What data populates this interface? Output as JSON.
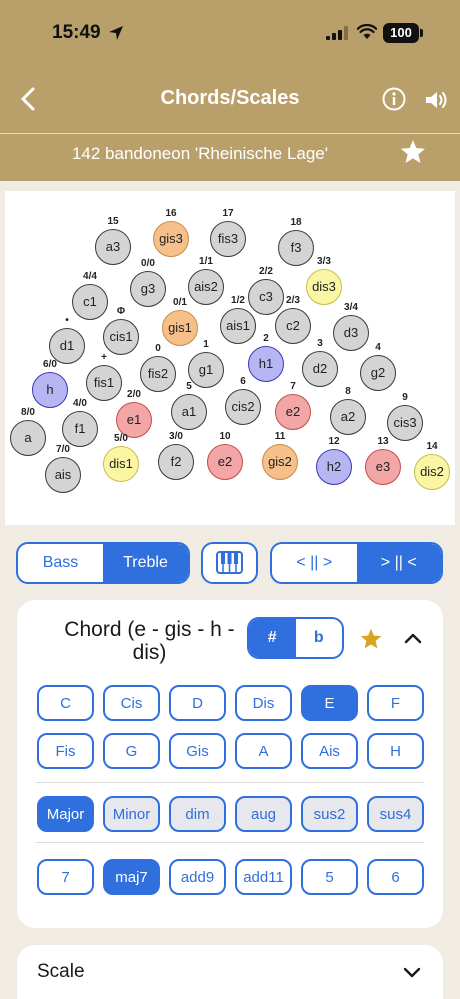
{
  "status": {
    "time": "15:49",
    "battery": "100"
  },
  "header": {
    "title": "Chords/Scales"
  },
  "instrument": {
    "name": "142 bandoneon 'Rheinische Lage'"
  },
  "colors": {
    "header_bg": "#b9a06a",
    "accent_blue": "#2f6fde",
    "page_bg": "#f1ece3",
    "key_default": "#d4d4d4",
    "key_orange": "#f6c08a",
    "key_yellow": "#fbf6a4",
    "key_blue": "#b8b6f2",
    "key_red": "#f2a6a6",
    "star_gold": "#d9a520"
  },
  "icons": [
    "location-arrow-icon",
    "signal-icon",
    "wifi-icon",
    "back-chevron-icon",
    "info-icon",
    "speaker-icon",
    "star-icon",
    "piano-icon",
    "chevron-up-icon",
    "chevron-down-icon"
  ],
  "keys": [
    {
      "label": "a3",
      "num": "15",
      "color": "default"
    },
    {
      "label": "gis3",
      "num": "16",
      "color": "orange"
    },
    {
      "label": "fis3",
      "num": "17",
      "color": "default"
    },
    {
      "label": "f3",
      "num": "18",
      "color": "default"
    },
    {
      "label": "c1",
      "num": "4/4",
      "color": "default"
    },
    {
      "label": "g3",
      "num": "0/0",
      "color": "default"
    },
    {
      "label": "ais2",
      "num": "1/1",
      "color": "default"
    },
    {
      "label": "c3",
      "num": "2/2",
      "color": "default"
    },
    {
      "label": "dis3",
      "num": "3/3",
      "color": "yellow"
    },
    {
      "label": "d1",
      "num": "•",
      "color": "default"
    },
    {
      "label": "cis1",
      "num": "Φ",
      "color": "default"
    },
    {
      "label": "gis1",
      "num": "0/1",
      "color": "orange"
    },
    {
      "label": "ais1",
      "num": "1/2",
      "color": "default"
    },
    {
      "label": "c2",
      "num": "2/3",
      "color": "default"
    },
    {
      "label": "d3",
      "num": "3/4",
      "color": "default"
    },
    {
      "label": "h",
      "num": "6/0",
      "color": "blue"
    },
    {
      "label": "fis1",
      "num": "+",
      "color": "default"
    },
    {
      "label": "fis2",
      "num": "0",
      "color": "default"
    },
    {
      "label": "g1",
      "num": "1",
      "color": "default"
    },
    {
      "label": "h1",
      "num": "2",
      "color": "blue"
    },
    {
      "label": "d2",
      "num": "3",
      "color": "default"
    },
    {
      "label": "g2",
      "num": "4",
      "color": "default"
    },
    {
      "label": "a",
      "num": "8/0",
      "color": "default"
    },
    {
      "label": "f1",
      "num": "4/0",
      "color": "default"
    },
    {
      "label": "e1",
      "num": "2/0",
      "color": "red"
    },
    {
      "label": "a1",
      "num": "5",
      "color": "default"
    },
    {
      "label": "cis2",
      "num": "6",
      "color": "default"
    },
    {
      "label": "e2",
      "num": "7",
      "color": "red"
    },
    {
      "label": "a2",
      "num": "8",
      "color": "default"
    },
    {
      "label": "cis3",
      "num": "9",
      "color": "default"
    },
    {
      "label": "ais",
      "num": "7/0",
      "color": "default"
    },
    {
      "label": "dis1",
      "num": "5/0",
      "color": "yellow"
    },
    {
      "label": "f2",
      "num": "3/0",
      "color": "default"
    },
    {
      "label": "e2",
      "num": "10",
      "color": "red"
    },
    {
      "label": "gis2",
      "num": "11",
      "color": "orange"
    },
    {
      "label": "h2",
      "num": "12",
      "color": "blue"
    },
    {
      "label": "e3",
      "num": "13",
      "color": "red"
    },
    {
      "label": "dis2",
      "num": "14",
      "color": "yellow"
    }
  ],
  "controls": {
    "bass": "Bass",
    "treble": "Treble",
    "selected_side": "Treble",
    "push": "< || >",
    "pull": "> || <",
    "selected_direction": "> || <"
  },
  "chord": {
    "title": "Chord (e - gis - h - dis)",
    "sharp": "#",
    "flat": "b",
    "selected_accidental": "#",
    "roots": [
      "C",
      "Cis",
      "D",
      "Dis",
      "E",
      "F",
      "Fis",
      "G",
      "Gis",
      "A",
      "Ais",
      "H"
    ],
    "selected_root": "E",
    "qualities": [
      "Major",
      "Minor",
      "dim",
      "aug",
      "sus2",
      "sus4"
    ],
    "selected_quality": "Major",
    "extensions": [
      "7",
      "maj7",
      "add9",
      "add11",
      "5",
      "6"
    ],
    "selected_extension": "maj7"
  },
  "scale": {
    "label": "Scale"
  }
}
